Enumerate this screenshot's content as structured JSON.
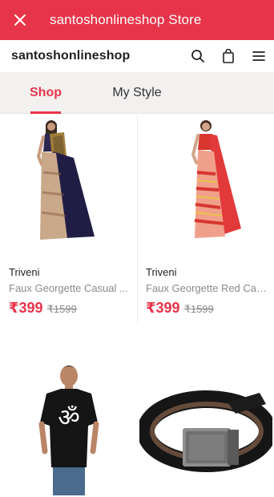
{
  "topbar": {
    "title": "santoshonlineshop Store",
    "bg_color": "#e8344a",
    "close_icon": "close-icon"
  },
  "header": {
    "brand": "santoshonlineshop",
    "icons": [
      "search-icon",
      "bag-icon",
      "menu-icon"
    ]
  },
  "tabs": [
    {
      "label": "Shop",
      "active": true
    },
    {
      "label": "My Style",
      "active": false
    }
  ],
  "accent_color": "#e8344a",
  "products": [
    {
      "brand": "Triveni",
      "name": "Faux Georgette Casual ...",
      "price": "₹399",
      "mrp": "₹1599",
      "image": "navy-saree"
    },
    {
      "brand": "Triveni",
      "name": "Faux Georgette Red Cas...",
      "price": "₹399",
      "mrp": "₹1599",
      "image": "red-saree"
    },
    {
      "brand": "",
      "name": "",
      "price": "",
      "mrp": "",
      "image": "black-om-tshirt"
    },
    {
      "brand": "",
      "name": "",
      "price": "",
      "mrp": "",
      "image": "black-leather-belt"
    }
  ]
}
